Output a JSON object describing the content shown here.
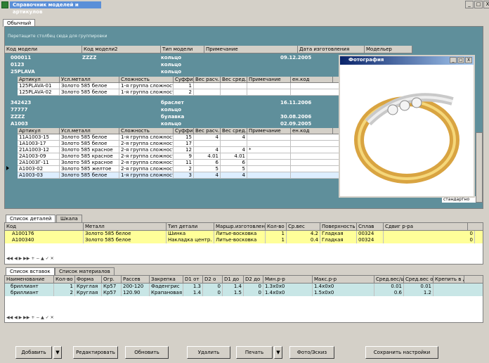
{
  "window": {
    "title": "Справочник моделей и артикулов",
    "min": "_",
    "max": "□",
    "close": "X"
  },
  "tab_main": "Обычный",
  "group_hint": "Перетащите столбец сюда для группировки",
  "grid": {
    "headers": [
      "Код модели",
      "Код модели2",
      "Тип модели",
      "Примечание",
      "Дата изготовления",
      "Модельер"
    ],
    "subheaders": [
      "Артикул",
      "Усл.металл",
      "Сложность",
      "Суффикс",
      "Вес расч.",
      "Вес сред.",
      "Примечание",
      "ен.код"
    ],
    "groups": [
      {
        "code": "000011",
        "code2": "ZZZZ",
        "type": "кольцо",
        "date": "09.12.2005"
      },
      {
        "code": "0123",
        "code2": "",
        "type": "кольцо",
        "date": ""
      },
      {
        "code": "25PLAVA",
        "code2": "",
        "type": "кольцо",
        "date": ""
      }
    ],
    "sub1": [
      {
        "art": "125PLAVA-01",
        "metal": "Золото 585 белое",
        "cx": "1-я группа сложности",
        "suf": "1",
        "w1": "",
        "w2": ""
      },
      {
        "art": "125PLAVA-02",
        "metal": "Золото 585 белое",
        "cx": "1-я группа сложности",
        "suf": "2",
        "w1": "",
        "w2": ""
      }
    ],
    "groups2": [
      {
        "code": "342423",
        "type": "браслет",
        "date": "16.11.2006"
      },
      {
        "code": "77777",
        "type": "кольцо",
        "date": ""
      },
      {
        "code": "ZZZZ",
        "type": "булавка",
        "date": "30.08.2006"
      },
      {
        "code": "A1003",
        "type": "кольцо",
        "date": "02.09.2005"
      }
    ],
    "sub2": [
      {
        "art": "11A1003-15",
        "metal": "Золото 585 белое",
        "cx": "1-я группа сложности",
        "suf": "15",
        "w1": "4",
        "w2": "4",
        "note": ""
      },
      {
        "art": "1A1003-17",
        "metal": "Золото 585 белое",
        "cx": "2-я группа сложности",
        "suf": "17",
        "w1": "",
        "w2": "",
        "note": ""
      },
      {
        "art": "21A1003-12",
        "metal": "Золото 585 красное",
        "cx": "2-я группа сложности",
        "suf": "12",
        "w1": "4",
        "w2": "4",
        "note": "*"
      },
      {
        "art": "2A1003-09",
        "metal": "Золото 585 красное",
        "cx": "2-я группа сложности",
        "suf": "9",
        "w1": "4.01",
        "w2": "4.01",
        "note": ""
      },
      {
        "art": "2A1003Г-11",
        "metal": "Золото 585 красное",
        "cx": "2-я группа сложности",
        "suf": "11",
        "w1": "6",
        "w2": "6",
        "note": ""
      },
      {
        "art": "A1003-02",
        "metal": "Золото 585 желтое",
        "cx": "2-я группа сложности",
        "suf": "2",
        "w1": "5",
        "w2": "5",
        "note": ""
      },
      {
        "art": "A1003-03",
        "metal": "Золото 585 белое",
        "cx": "1-я группа сложности",
        "suf": "3",
        "w1": "4",
        "w2": "4",
        "note": ""
      }
    ],
    "extra_cell": "стандартно"
  },
  "photo": {
    "title": "Фотография"
  },
  "tabs_details": [
    "Список деталей",
    "Шкала"
  ],
  "details": {
    "headers": [
      "Код",
      "Металл",
      "Тип детали",
      "Маршр.изготовления",
      "Кол-во",
      "Ср.вес",
      "Поверхность",
      "Сплав",
      "Сдвиг р-ра"
    ],
    "rows": [
      {
        "code": "A100176",
        "metal": "Золото 585 белое",
        "type": "Шинка",
        "route": "Литье-восковка",
        "qty": "1",
        "w": "4.2",
        "surf": "Гладкая",
        "alloy": "00324",
        "shift": "0"
      },
      {
        "code": "A100340",
        "metal": "Золото 585 белое",
        "type": "Накладка центр.",
        "route": "Литье-восковка",
        "qty": "1",
        "w": "0.4",
        "surf": "Гладкая",
        "alloy": "00324",
        "shift": "0"
      }
    ]
  },
  "tabs_inserts": [
    "Список вставок",
    "Список материалов"
  ],
  "inserts": {
    "headers": [
      "Наименование",
      "Кол-во",
      "Форма",
      "Огр.",
      "Рассев",
      "Закрепка",
      "D1 от",
      "D2 о",
      "D1 до",
      "D2 до",
      "Мин.р-р",
      "Макс.р-р",
      "Сред.вес/ш",
      "Сред.вес общ",
      "Крепить в д"
    ],
    "rows": [
      {
        "name": "бриллиант",
        "qty": "1",
        "form": "Круглая",
        "ogr": "Кр57",
        "ras": "200-120",
        "zak": "Фаденгрис",
        "d1": "1.3",
        "d2": "0",
        "d1d": "1.4",
        "d2d": "0",
        "min": "1.3х0х0",
        "max": "1.4х0х0",
        "sw": "0.01",
        "sa": "0.01"
      },
      {
        "name": "бриллиант",
        "qty": "2",
        "form": "Круглая",
        "ogr": "Кр57",
        "ras": "120.90",
        "zak": "Крапановая",
        "d1": "1.4",
        "d2": "0",
        "d1d": "1.5",
        "d2d": "0",
        "min": "1.4х0х0",
        "max": "1.5х0х0",
        "sw": "0.6",
        "sa": "1.2"
      }
    ]
  },
  "buttons": {
    "add": "Добавить",
    "edit": "Редактировать",
    "refresh": "Обновить",
    "delete": "Удалить",
    "print": "Печать",
    "photo": "Фото/Эскиз",
    "save": "Сохранить настройки"
  }
}
